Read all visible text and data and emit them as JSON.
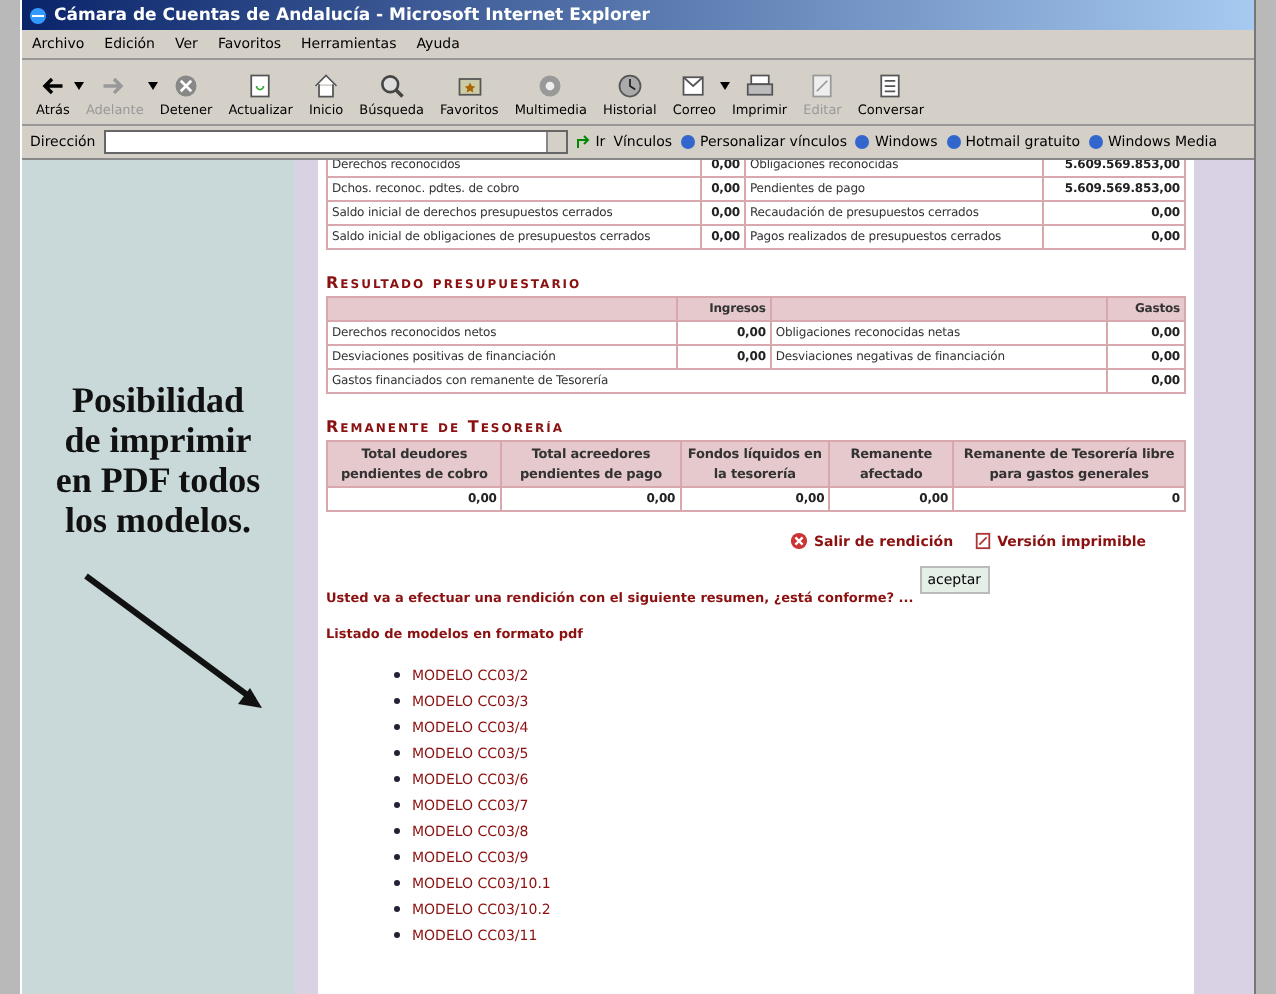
{
  "window": {
    "title": "Cámara de Cuentas de Andalucía - Microsoft Internet Explorer"
  },
  "menu": [
    "Archivo",
    "Edición",
    "Ver",
    "Favoritos",
    "Herramientas",
    "Ayuda"
  ],
  "toolbar": [
    {
      "label": "Atrás",
      "disabled": false,
      "dropdown": true
    },
    {
      "label": "Adelante",
      "disabled": true,
      "dropdown": true
    },
    {
      "label": "Detener",
      "disabled": false,
      "dropdown": false
    },
    {
      "label": "Actualizar",
      "disabled": false,
      "dropdown": false
    },
    {
      "label": "Inicio",
      "disabled": false,
      "dropdown": false
    },
    {
      "label": "Búsqueda",
      "disabled": false,
      "dropdown": false
    },
    {
      "label": "Favoritos",
      "disabled": false,
      "dropdown": false
    },
    {
      "label": "Multimedia",
      "disabled": false,
      "dropdown": false
    },
    {
      "label": "Historial",
      "disabled": false,
      "dropdown": false
    },
    {
      "label": "Correo",
      "disabled": false,
      "dropdown": true
    },
    {
      "label": "Imprimir",
      "disabled": false,
      "dropdown": false
    },
    {
      "label": "Editar",
      "disabled": true,
      "dropdown": false
    },
    {
      "label": "Conversar",
      "disabled": false,
      "dropdown": false
    }
  ],
  "address_bar": {
    "label": "Dirección",
    "go": "Ir",
    "links_label": "Vínculos",
    "links": [
      "Personalizar vínculos",
      "Windows",
      "Hotmail gratuito",
      "Windows Media"
    ]
  },
  "annotation": {
    "lines": [
      "Posibilidad",
      "de imprimir",
      "en PDF todos",
      "los modelos."
    ]
  },
  "summary_table": {
    "rows": [
      [
        "Derechos reconocidos",
        "0,00",
        "Obligaciones reconocidas",
        "5.609.569.853,00"
      ],
      [
        "Dchos. reconoc. pdtes. de cobro",
        "0,00",
        "Pendientes de pago",
        "5.609.569.853,00"
      ],
      [
        "Saldo inicial de derechos presupuestos cerrados",
        "0,00",
        "Recaudación de presupuestos cerrados",
        "0,00"
      ],
      [
        "Saldo inicial de obligaciones de presupuestos cerrados",
        "0,00",
        "Pagos realizados de presupuestos cerrados",
        "0,00"
      ]
    ]
  },
  "resultado": {
    "title": "Resultado presupuestario",
    "headers": [
      "Ingresos",
      "Gastos"
    ],
    "rows": [
      [
        "Derechos reconocidos netos",
        "0,00",
        "Obligaciones reconocidas netas",
        "0,00"
      ],
      [
        "Desviaciones positivas de financiación",
        "0,00",
        "Desviaciones negativas de financiación",
        "0,00"
      ]
    ],
    "total_row": [
      "Gastos financiados con remanente de Tesorería",
      "0,00"
    ]
  },
  "remanente": {
    "title": "Remanente de Tesorería",
    "columns": [
      "Total deudores pendientes de cobro",
      "Total acreedores pendientes de pago",
      "Fondos líquidos en la tesorería",
      "Remanente afectado",
      "Remanente de Tesorería libre para gastos generales"
    ],
    "values": [
      "0,00",
      "0,00",
      "0,00",
      "0,00",
      "0"
    ]
  },
  "actions": [
    "Salir de rendición",
    "Versión imprimible"
  ],
  "confirm": {
    "text": "Usted va a efectuar una rendición con el siguiente resumen, ¿está conforme? ...",
    "button": "aceptar"
  },
  "models": {
    "heading": "Listado de modelos en formato pdf",
    "items": [
      "MODELO CC03/2",
      "MODELO CC03/3",
      "MODELO CC03/4",
      "MODELO CC03/5",
      "MODELO CC03/6",
      "MODELO CC03/7",
      "MODELO CC03/8",
      "MODELO CC03/9",
      "MODELO CC03/10.1",
      "MODELO CC03/10.2",
      "MODELO CC03/11"
    ]
  }
}
